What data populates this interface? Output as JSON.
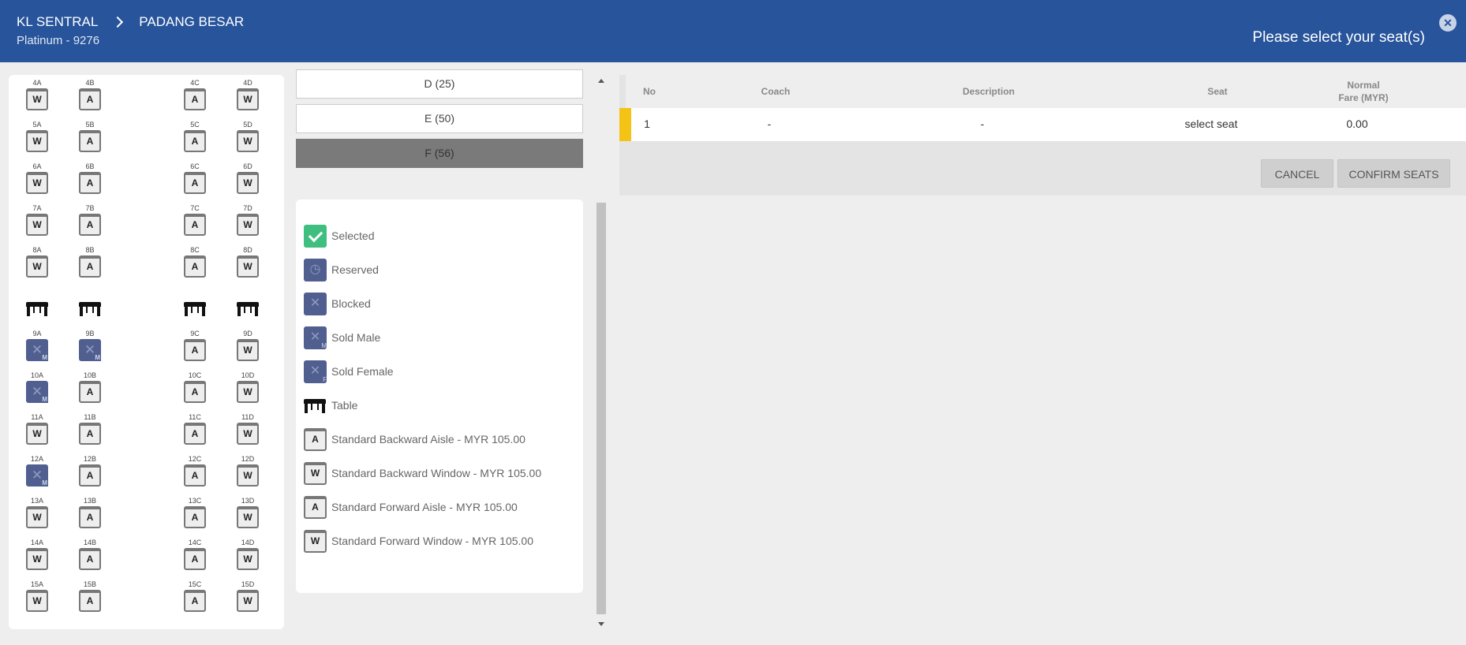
{
  "header": {
    "origin": "KL SENTRAL",
    "destination": "PADANG BESAR",
    "service": "Platinum - 9276",
    "prompt": "Please select your seat(s)"
  },
  "seat_rows": [
    {
      "row": "4",
      "seats": [
        {
          "label": "4A",
          "type": "W"
        },
        {
          "label": "4B",
          "type": "A"
        },
        {
          "label": "4C",
          "type": "A"
        },
        {
          "label": "4D",
          "type": "W"
        }
      ]
    },
    {
      "row": "5",
      "seats": [
        {
          "label": "5A",
          "type": "W"
        },
        {
          "label": "5B",
          "type": "A"
        },
        {
          "label": "5C",
          "type": "A"
        },
        {
          "label": "5D",
          "type": "W"
        }
      ]
    },
    {
      "row": "6",
      "seats": [
        {
          "label": "6A",
          "type": "W"
        },
        {
          "label": "6B",
          "type": "A"
        },
        {
          "label": "6C",
          "type": "A"
        },
        {
          "label": "6D",
          "type": "W"
        }
      ]
    },
    {
      "row": "7",
      "seats": [
        {
          "label": "7A",
          "type": "W"
        },
        {
          "label": "7B",
          "type": "A"
        },
        {
          "label": "7C",
          "type": "A"
        },
        {
          "label": "7D",
          "type": "W"
        }
      ]
    },
    {
      "row": "8",
      "seats": [
        {
          "label": "8A",
          "type": "W"
        },
        {
          "label": "8B",
          "type": "A"
        },
        {
          "label": "8C",
          "type": "A"
        },
        {
          "label": "8D",
          "type": "W"
        }
      ]
    },
    {
      "row": "tables",
      "tables": true
    },
    {
      "row": "9",
      "seats": [
        {
          "label": "9A",
          "type": "sold",
          "mark": "M"
        },
        {
          "label": "9B",
          "type": "sold",
          "mark": "M"
        },
        {
          "label": "9C",
          "type": "A"
        },
        {
          "label": "9D",
          "type": "W"
        }
      ]
    },
    {
      "row": "10",
      "seats": [
        {
          "label": "10A",
          "type": "sold",
          "mark": "M"
        },
        {
          "label": "10B",
          "type": "A"
        },
        {
          "label": "10C",
          "type": "A"
        },
        {
          "label": "10D",
          "type": "W"
        }
      ]
    },
    {
      "row": "11",
      "seats": [
        {
          "label": "11A",
          "type": "W"
        },
        {
          "label": "11B",
          "type": "A"
        },
        {
          "label": "11C",
          "type": "A"
        },
        {
          "label": "11D",
          "type": "W"
        }
      ]
    },
    {
      "row": "12",
      "seats": [
        {
          "label": "12A",
          "type": "sold",
          "mark": "M"
        },
        {
          "label": "12B",
          "type": "A"
        },
        {
          "label": "12C",
          "type": "A"
        },
        {
          "label": "12D",
          "type": "W"
        }
      ]
    },
    {
      "row": "13",
      "seats": [
        {
          "label": "13A",
          "type": "W"
        },
        {
          "label": "13B",
          "type": "A"
        },
        {
          "label": "13C",
          "type": "A"
        },
        {
          "label": "13D",
          "type": "W"
        }
      ]
    },
    {
      "row": "14",
      "seats": [
        {
          "label": "14A",
          "type": "W"
        },
        {
          "label": "14B",
          "type": "A"
        },
        {
          "label": "14C",
          "type": "A"
        },
        {
          "label": "14D",
          "type": "W"
        }
      ]
    },
    {
      "row": "15",
      "seats": [
        {
          "label": "15A",
          "type": "W"
        },
        {
          "label": "15B",
          "type": "A"
        },
        {
          "label": "15C",
          "type": "A"
        },
        {
          "label": "15D",
          "type": "W"
        }
      ]
    }
  ],
  "coaches": [
    {
      "label": "D (25)",
      "active": false
    },
    {
      "label": "E (50)",
      "active": false
    },
    {
      "label": "F (56)",
      "active": true
    }
  ],
  "legend": [
    {
      "kind": "selected",
      "label": "Selected"
    },
    {
      "kind": "reserved",
      "label": "Reserved"
    },
    {
      "kind": "blocked",
      "label": "Blocked"
    },
    {
      "kind": "sold-male",
      "label": "Sold Male",
      "mark": "M"
    },
    {
      "kind": "sold-female",
      "label": "Sold Female",
      "mark": "F"
    },
    {
      "kind": "table",
      "label": "Table"
    },
    {
      "kind": "seat",
      "glyph": "A",
      "label": "Standard Backward Aisle - MYR 105.00"
    },
    {
      "kind": "seat",
      "glyph": "W",
      "label": "Standard Backward Window - MYR 105.00"
    },
    {
      "kind": "seat",
      "glyph": "A",
      "label": "Standard Forward Aisle - MYR 105.00"
    },
    {
      "kind": "seat",
      "glyph": "W",
      "label": "Standard Forward Window - MYR 105.00"
    }
  ],
  "summary": {
    "columns": {
      "no": "No",
      "coach": "Coach",
      "description": "Description",
      "seat": "Seat",
      "fare_line1": "Normal",
      "fare_line2": "Fare (MYR)"
    },
    "rows": [
      {
        "no": "1",
        "coach": "-",
        "description": "-",
        "seat": "select seat",
        "fare": "0.00"
      }
    ],
    "cancel_label": "CANCEL",
    "confirm_label": "CONFIRM SEATS"
  },
  "colors": {
    "header": "#27549b",
    "selected": "#3fbf7f",
    "sold": "#505f8f",
    "row_accent": "#f3c316"
  }
}
